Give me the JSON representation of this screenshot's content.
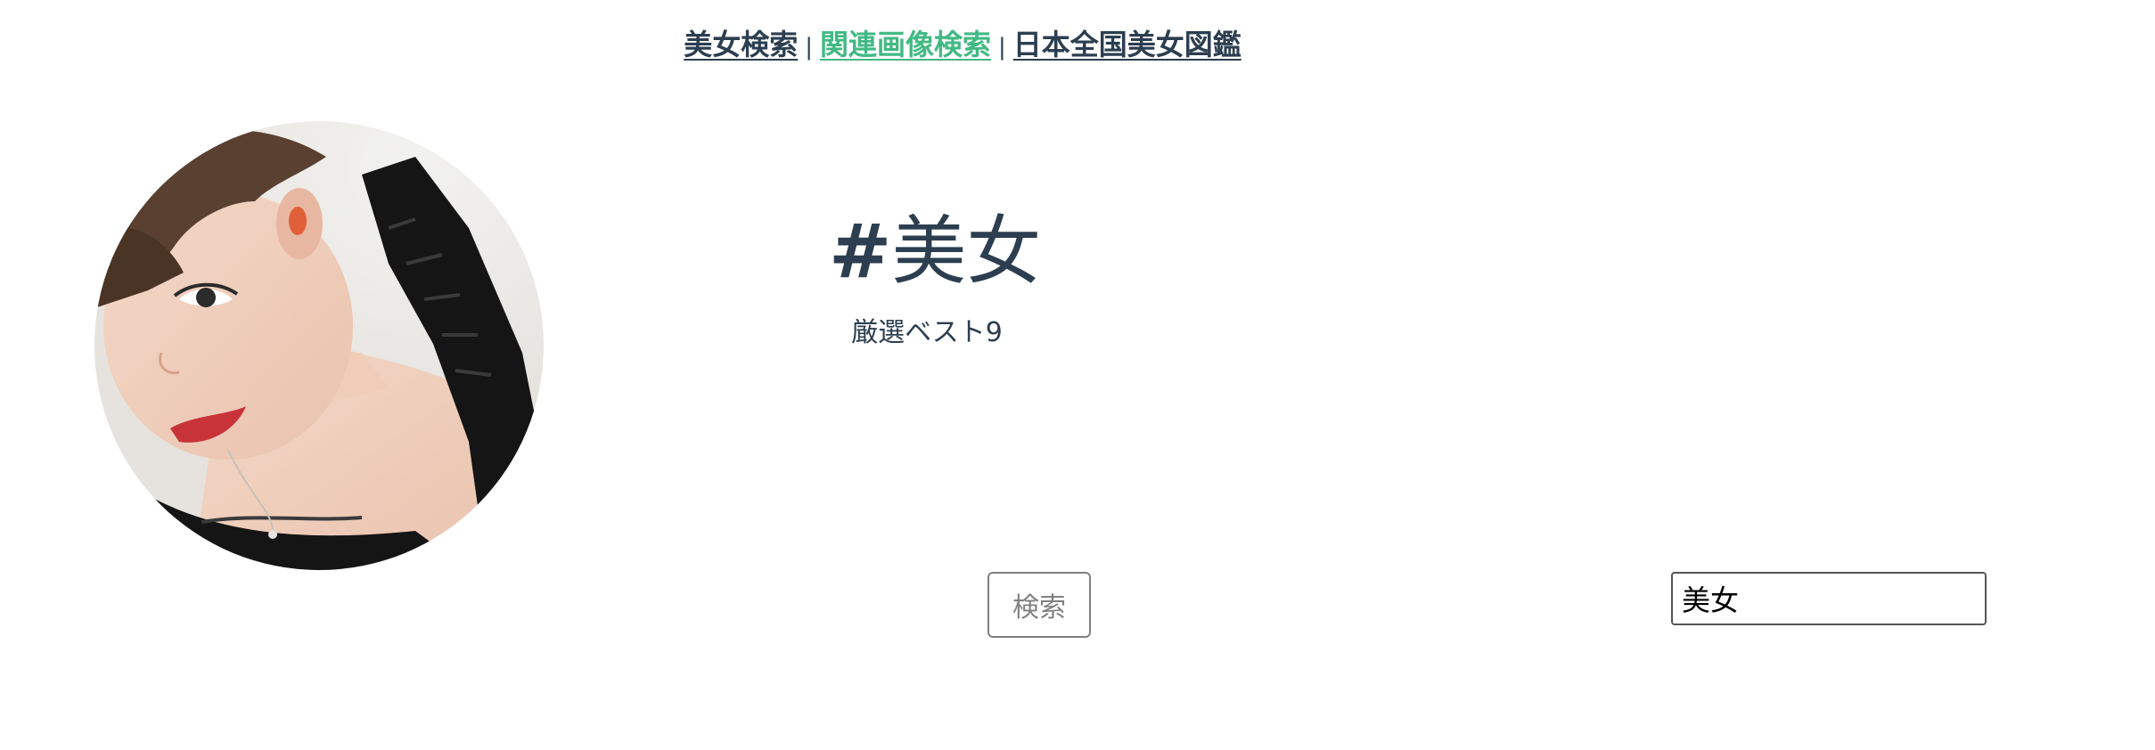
{
  "nav": {
    "items": [
      {
        "label": "美女検索",
        "active": false
      },
      {
        "label": "関連画像検索",
        "active": true
      },
      {
        "label": "日本全国美女図鑑",
        "active": false
      }
    ],
    "separator": "|",
    "active_color": "#42b983",
    "text_color": "#2c3e50"
  },
  "profile": {
    "image_icon": "portrait-photo"
  },
  "header": {
    "title_hash": "#",
    "title_text": "美女",
    "subtitle": "厳選ベスト9"
  },
  "search": {
    "button_label": "検索",
    "input_value": "美女"
  }
}
